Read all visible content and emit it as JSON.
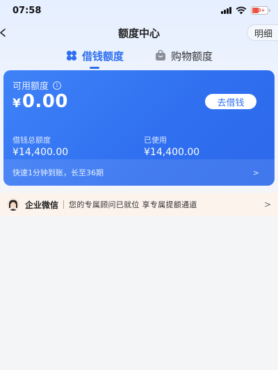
{
  "status_bar": {
    "time": "07:58",
    "battery": "10+"
  },
  "nav": {
    "title": "额度中心",
    "detail_label": "明细"
  },
  "tabs": [
    {
      "label": "借钱额度",
      "active": true,
      "icon": "clover-icon"
    },
    {
      "label": "购物额度",
      "active": false,
      "icon": "shopping-bag-icon"
    }
  ],
  "credit": {
    "available_label": "可用额度",
    "currency": "¥",
    "available_amount": "0.00",
    "borrow_button": "去借钱",
    "total_label": "借钱总额度",
    "total_value": "¥14,400.00",
    "used_label": "已使用",
    "used_value": "¥14,400.00",
    "promo_text": "快速1分钟到账，长至36期",
    "promo_chevron": ">"
  },
  "wecom": {
    "name": "企业微信",
    "message": "您的专属顾问已就位 享专属提额通道",
    "chevron": ">"
  },
  "colors": {
    "accent": "#2f6ff0",
    "card": "#3a7cf6",
    "banner": "#fcf3ec",
    "battery_low": "#f05a4f"
  }
}
